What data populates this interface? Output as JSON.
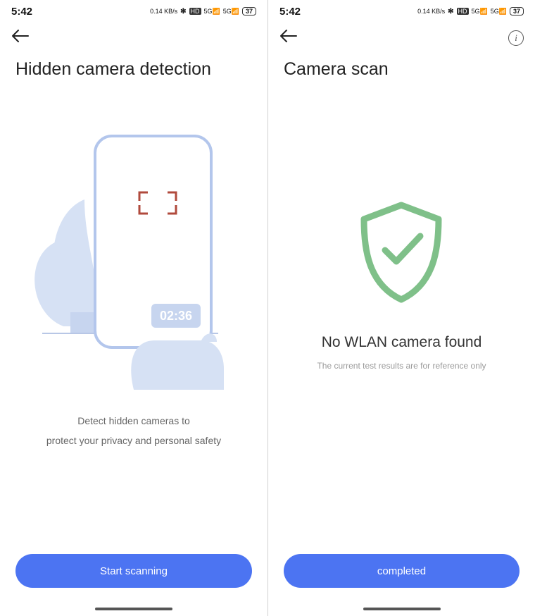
{
  "status": {
    "time": "5:42",
    "kbps": "0.14 KB/s",
    "hd": "HD",
    "net1": "5G",
    "net2": "5G",
    "battery": "37"
  },
  "left": {
    "title": "Hidden camera detection",
    "illustration_time": "02:36",
    "desc_line1": "Detect hidden cameras to",
    "desc_line2": "protect your privacy and personal safety",
    "button": "Start scanning"
  },
  "right": {
    "title": "Camera scan",
    "result_title": "No WLAN camera found",
    "result_sub": "The current test results are for reference only",
    "button": "completed"
  }
}
